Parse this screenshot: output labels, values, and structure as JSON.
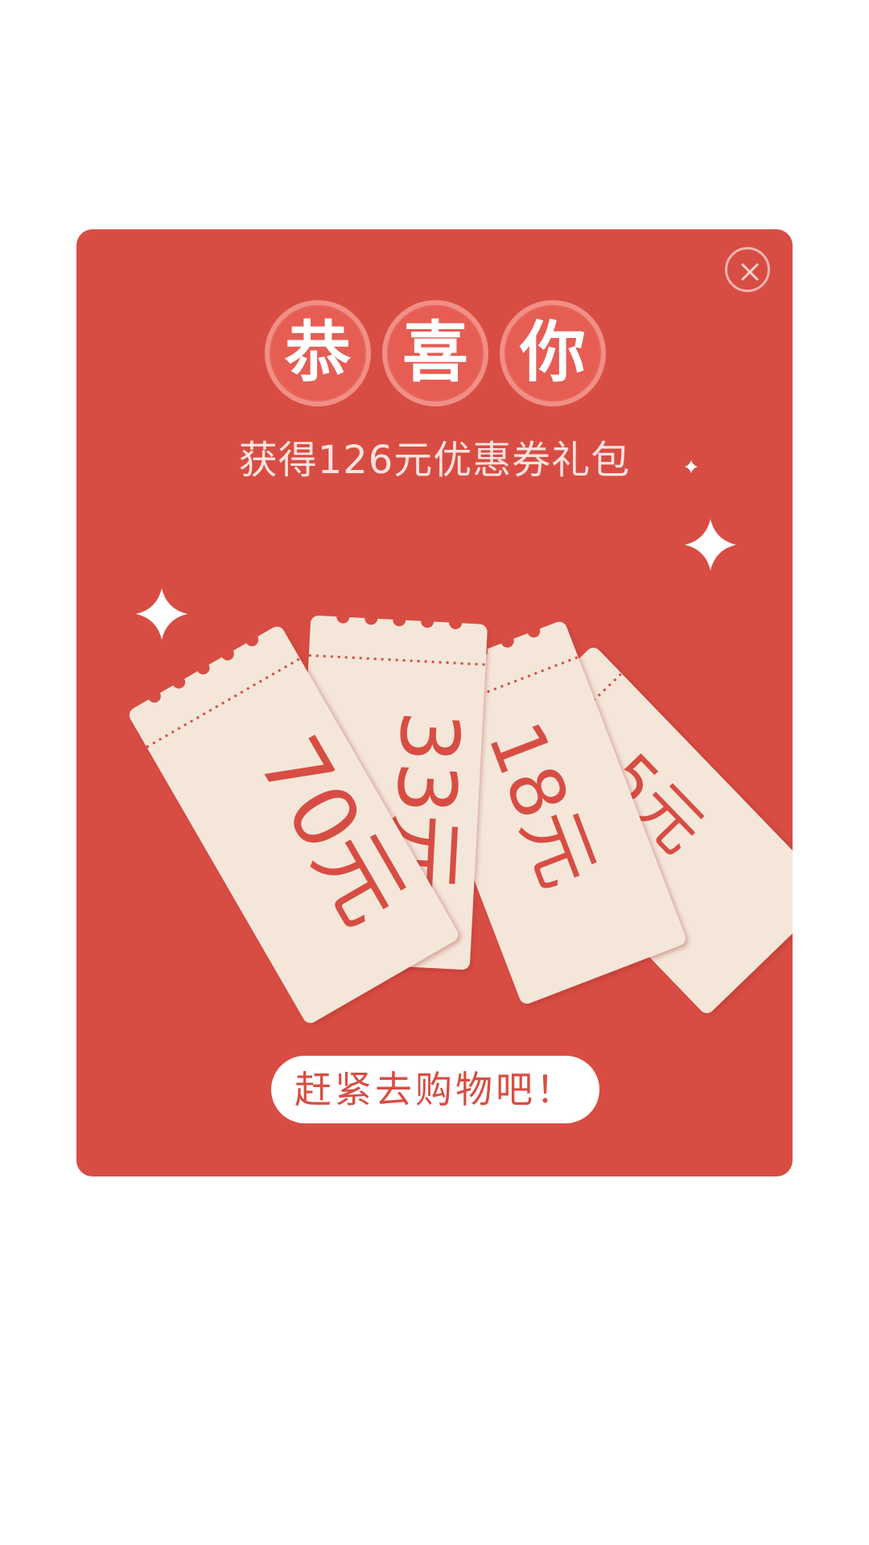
{
  "dialog": {
    "title_chars": [
      "恭",
      "喜",
      "你"
    ],
    "subtitle": "获得126元优惠券礼包",
    "cta_label": "赶紧去购物吧！"
  },
  "coupons": [
    {
      "value_label": "70元"
    },
    {
      "value_label": "33元"
    },
    {
      "value_label": "18元"
    },
    {
      "value_label": "5元"
    }
  ],
  "icons": {
    "close": "close-icon",
    "sparkle": "sparkle-icon"
  },
  "colors": {
    "modal_bg": "#d84d43",
    "ticket_bg": "#f4e7da",
    "accent": "#d84d43",
    "button_bg": "#ffffff"
  }
}
